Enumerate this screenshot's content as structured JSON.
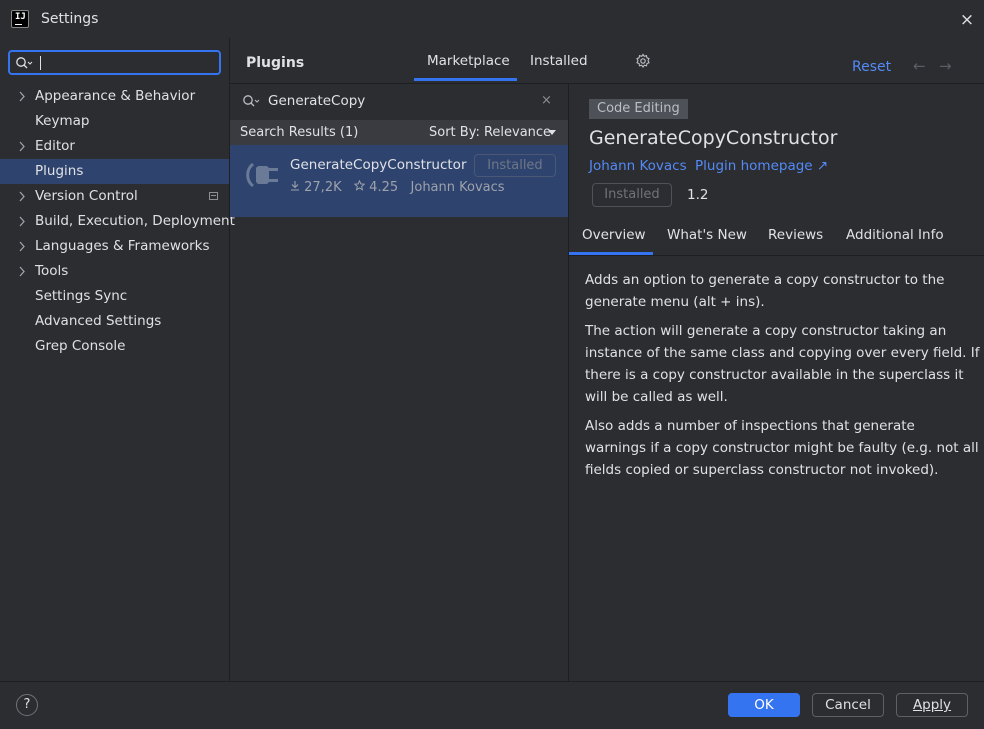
{
  "window": {
    "title": "Settings",
    "close_icon": "×"
  },
  "sidebar": {
    "search_value": "",
    "items": [
      {
        "label": "Appearance & Behavior",
        "expandable": true
      },
      {
        "label": "Keymap",
        "expandable": false
      },
      {
        "label": "Editor",
        "expandable": true
      },
      {
        "label": "Plugins",
        "expandable": false,
        "selected": true
      },
      {
        "label": "Version Control",
        "expandable": true
      },
      {
        "label": "Build, Execution, Deployment",
        "expandable": true
      },
      {
        "label": "Languages & Frameworks",
        "expandable": true
      },
      {
        "label": "Tools",
        "expandable": true
      },
      {
        "label": "Settings Sync",
        "expandable": false
      },
      {
        "label": "Advanced Settings",
        "expandable": false
      },
      {
        "label": "Grep Console",
        "expandable": false
      }
    ]
  },
  "header": {
    "title": "Plugins",
    "tabs": [
      {
        "label": "Marketplace",
        "active": true
      },
      {
        "label": "Installed",
        "active": false
      }
    ],
    "reset_label": "Reset",
    "back_icon": "←",
    "forward_icon": "→"
  },
  "search": {
    "value": "GenerateCopy",
    "clear_icon": "×"
  },
  "results": {
    "label": "Search Results (1)",
    "sort_label": "Sort By: Relevance",
    "items": [
      {
        "name": "GenerateCopyConstructor",
        "status": "Installed",
        "downloads": "27,2K",
        "rating": "4.25",
        "author": "Johann Kovacs"
      }
    ]
  },
  "detail": {
    "category": "Code Editing",
    "title": "GenerateCopyConstructor",
    "author": "Johann Kovacs",
    "homepage": "Plugin homepage ↗",
    "status": "Installed",
    "version": "1.2",
    "tabs": [
      {
        "label": "Overview",
        "active": true
      },
      {
        "label": "What's New",
        "active": false
      },
      {
        "label": "Reviews",
        "active": false
      },
      {
        "label": "Additional Info",
        "active": false
      }
    ],
    "paragraphs": [
      "Adds an option to generate a copy constructor to the generate menu (alt + ins).",
      "The action will generate a copy constructor taking an instance of the same class and copying over every field. If there is a copy constructor available in the superclass it will be called as well.",
      "Also adds a number of inspections that generate warnings if a copy constructor might be faulty (e.g. not all fields copied or superclass constructor not invoked)."
    ]
  },
  "footer": {
    "help_label": "?",
    "ok_label": "OK",
    "cancel_label": "Cancel",
    "apply_label": "Apply"
  },
  "colors": {
    "accent": "#3574f0",
    "link": "#548af7",
    "selection": "#2e436e",
    "background": "#2b2d30"
  }
}
